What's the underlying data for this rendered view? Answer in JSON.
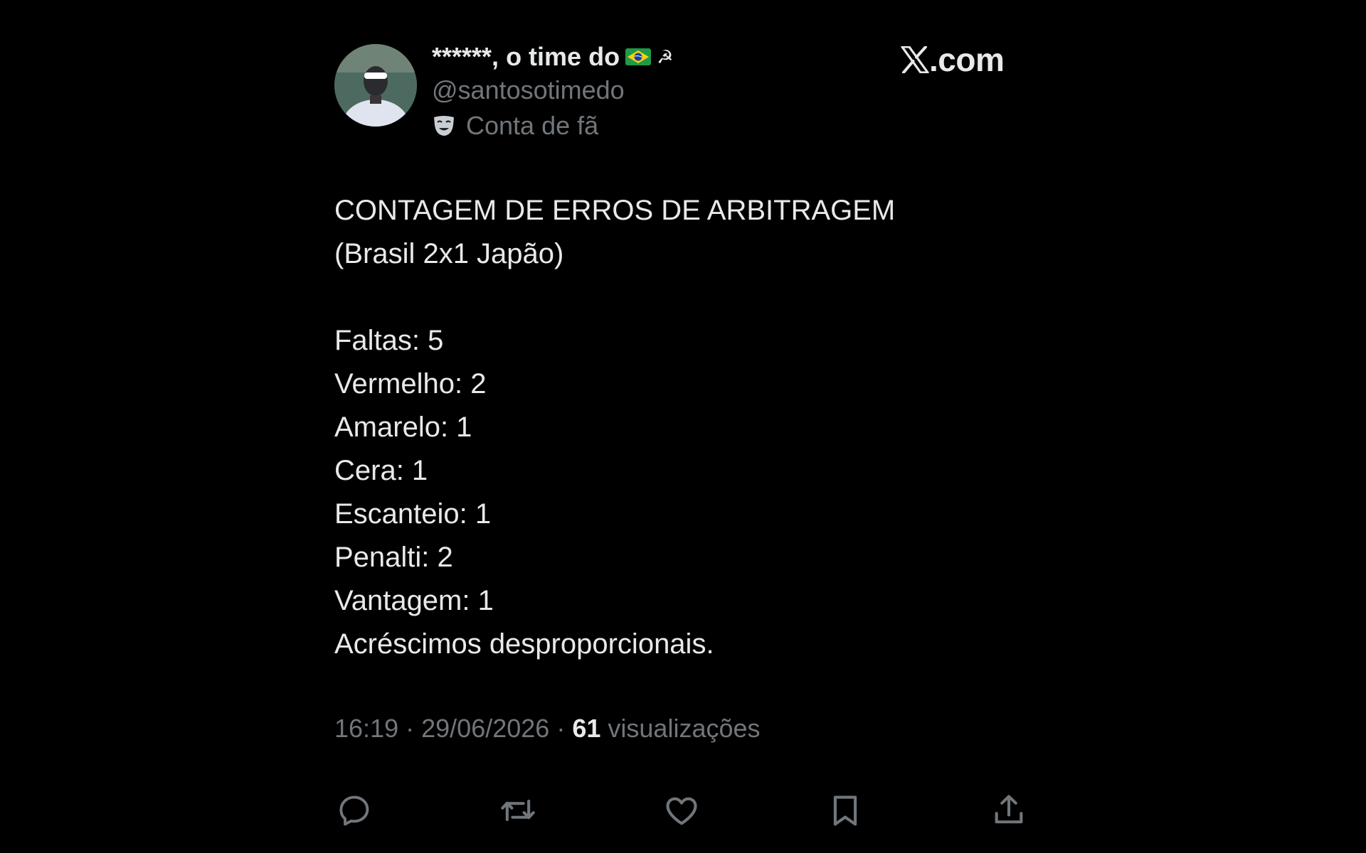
{
  "tweet": {
    "author": {
      "display_name": "******, o time do",
      "flag_icon": "brazil-flag-icon",
      "symbol_icon": "hammer-sickle-icon",
      "handle": "@santosotimedo",
      "badge_icon": "theater-mask-icon",
      "badge_label": "Conta de fã",
      "avatar": "avatar-photo"
    },
    "site_label": ".com",
    "site_logo_icon": "x-logo-icon",
    "text": {
      "title": "CONTAGEM DE ERROS DE ARBITRAGEM",
      "subtitle": "(Brasil 2x1 Japão)",
      "lines": [
        "Faltas: 5",
        "Vermelho: 2",
        "Amarelo: 1",
        "Cera: 1",
        "Escanteio: 1",
        "Penalti: 2",
        "Vantagem: 1",
        "Acréscimos desproporcionais."
      ]
    },
    "meta": {
      "time": "16:19",
      "separator": "·",
      "date": "29/06/2026",
      "views_count": "61",
      "views_label": "visualizações"
    },
    "actions": [
      {
        "name": "reply-icon"
      },
      {
        "name": "retweet-icon"
      },
      {
        "name": "like-icon"
      },
      {
        "name": "bookmark-icon"
      },
      {
        "name": "share-icon"
      }
    ]
  },
  "colors": {
    "background": "#000000",
    "primary_text": "#e7e9ea",
    "secondary_text": "#71767b"
  }
}
